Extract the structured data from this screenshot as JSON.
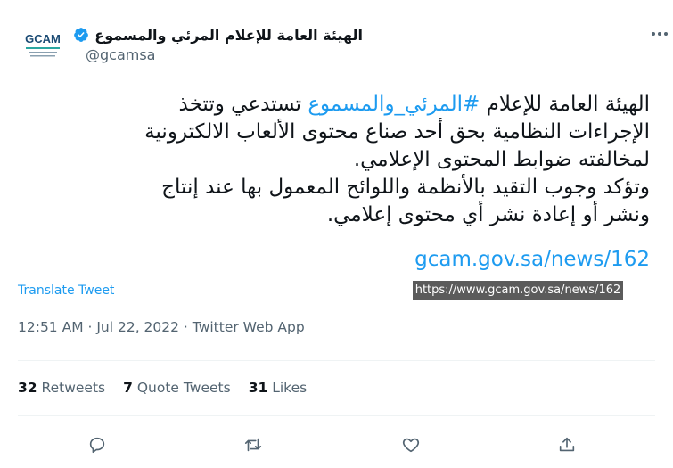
{
  "author": {
    "name": "الهيئة العامة للإعلام المرئي والمسموع",
    "handle": "@gcamsa",
    "verified": true,
    "avatar_text": "GCAM"
  },
  "tweet": {
    "line1_prefix": "الهيئة العامة للإعلام ",
    "hashtag": "#المرئي_والمسموع",
    "line1_suffix": " تستدعي وتتخذ",
    "rest": "الإجراءات النظامية بحق أحد صناع محتوى الألعاب الالكترونية\nلمخالفته ضوابط المحتوى الإعلامي.\nوتؤكد وجوب التقيد بالأنظمة واللوائح المعمول بها عند إنتاج\nونشر أو إعادة نشر أي محتوى إعلامي.",
    "link": "gcam.gov.sa/news/162",
    "tooltip": "https://www.gcam.gov.sa/news/162"
  },
  "translate_label": "Translate Tweet",
  "timestamp": "12:51 AM · Jul 22, 2022 · Twitter Web App",
  "stats": {
    "retweets_count": "32",
    "retweets_label": "Retweets",
    "quotes_count": "7",
    "quotes_label": "Quote Tweets",
    "likes_count": "31",
    "likes_label": "Likes"
  },
  "actions": [
    "reply-icon",
    "retweet-icon",
    "like-icon",
    "share-icon"
  ],
  "colors": {
    "accent": "#1d9bf0",
    "muted": "#536471",
    "text": "#0f1419",
    "tooltip_bg": "#5b5b5b"
  }
}
